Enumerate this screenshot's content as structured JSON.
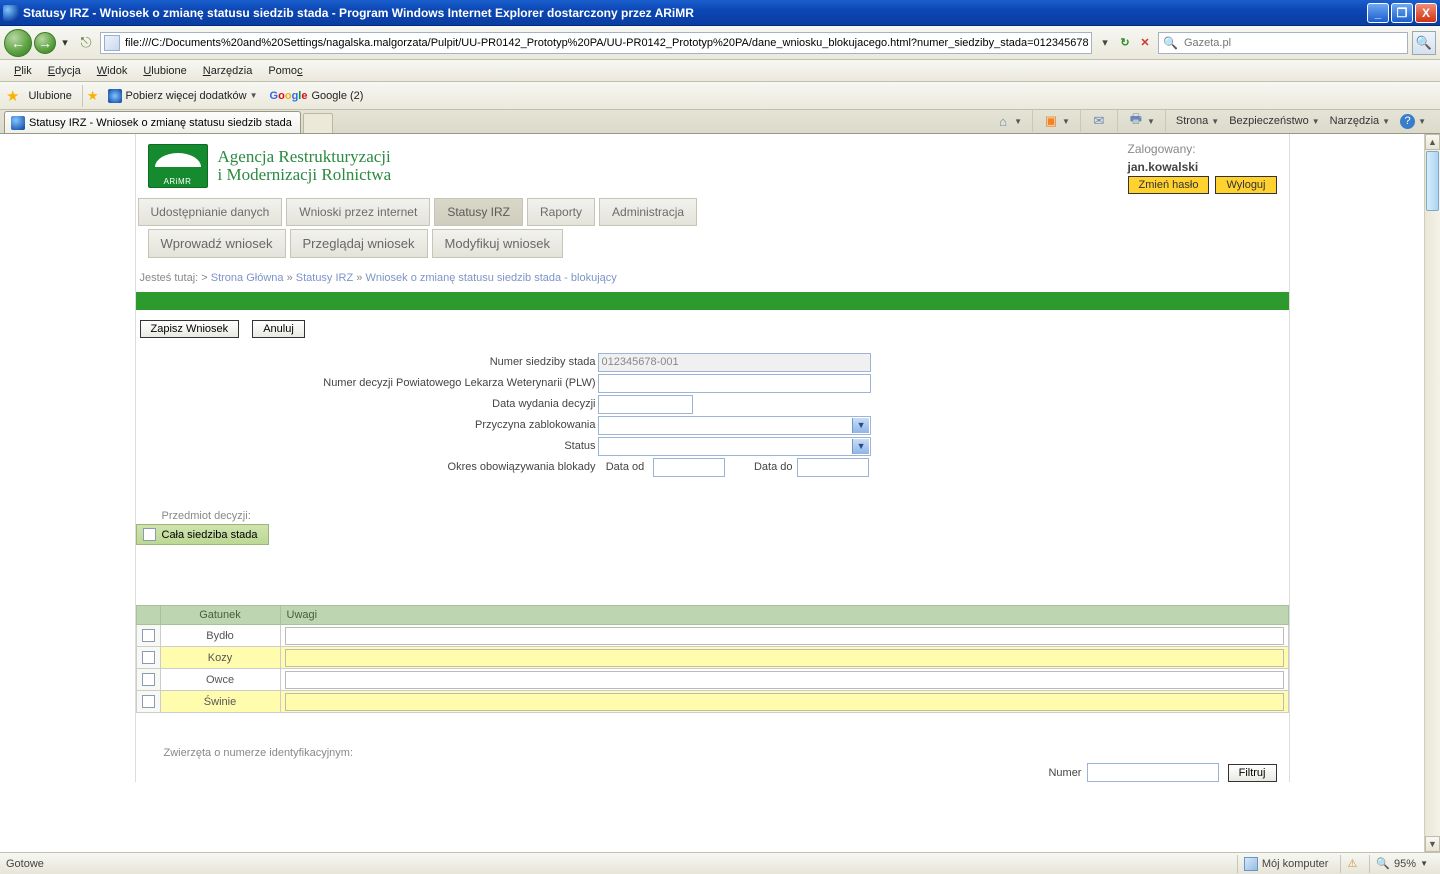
{
  "window": {
    "title": "Statusy IRZ - Wniosek o zmianę statusu siedzib stada - Program Windows Internet Explorer dostarczony przez ARiMR"
  },
  "address": {
    "url": "file:///C:/Documents%20and%20Settings/nagalska.malgorzata/Pulpit/UU-PR0142_Prototyp%20PA/UU-PR0142_Prototyp%20PA/dane_wniosku_blokujacego.html?numer_siedziby_stada=012345678"
  },
  "search": {
    "placeholder": "Gazeta.pl"
  },
  "menu": {
    "plik": "Plik",
    "edycja": "Edycja",
    "widok": "Widok",
    "ulubione": "Ulubione",
    "narzedzia": "Narzędzia",
    "pomoc": "Pomoc"
  },
  "favbar": {
    "ulubione": "Ulubione",
    "pobierz": "Pobierz więcej dodatków",
    "google": "Google (2)"
  },
  "tab": {
    "title": "Statusy IRZ - Wniosek o zmianę statusu siedzib stada"
  },
  "cmdbar": {
    "strona": "Strona",
    "bezp": "Bezpieczeństwo",
    "narz": "Narzędzia"
  },
  "brand": {
    "line1": "Agencja Restrukturyzacji",
    "line2": "i Modernizacji Rolnictwa"
  },
  "user": {
    "logged": "Zalogowany:",
    "name": "jan.kowalski",
    "change": "Zmień hasło",
    "logout": "Wyloguj"
  },
  "nav1": {
    "t1": "Udostępnianie danych",
    "t2": "Wnioski przez internet",
    "t3": "Statusy IRZ",
    "t4": "Raporty",
    "t5": "Administracja"
  },
  "nav2": {
    "t1": "Wprowadź wniosek",
    "t2": "Przeglądaj wniosek",
    "t3": "Modyfikuj wniosek"
  },
  "bc": {
    "pre": "Jesteś tutaj: > ",
    "a1": "Strona Główna",
    "s1": " » ",
    "a2": "Statusy IRZ",
    "s2": " » ",
    "a3": "Wniosek o zmianę statusu siedzib stada - blokujący"
  },
  "actions": {
    "save": "Zapisz Wniosek",
    "cancel": "Anuluj"
  },
  "form": {
    "l1": "Numer siedziby stada",
    "v1": "012345678-001",
    "l2": "Numer decyzji Powiatowego Lekarza Weterynarii (PLW)",
    "l3": "Data wydania decyzji",
    "l4": "Przyczyna zablokowania",
    "l5": "Status",
    "l6": "Okres obowiązywania blokady",
    "l6a": "Data od",
    "l6b": "Data do"
  },
  "subject": {
    "label": "Przedmiot decyzji:",
    "whole": "Cała siedziba stada"
  },
  "table": {
    "h1": "Gatunek",
    "h2": "Uwagi",
    "r1": "Bydło",
    "r2": "Kozy",
    "r3": "Owce",
    "r4": "Świnie"
  },
  "animals": {
    "label": "Zwierzęta o numerze identyfikacyjnym:",
    "numlabel": "Numer",
    "filter": "Filtruj"
  },
  "status": {
    "ready": "Gotowe",
    "computer": "Mój komputer",
    "zoom": "95%"
  }
}
